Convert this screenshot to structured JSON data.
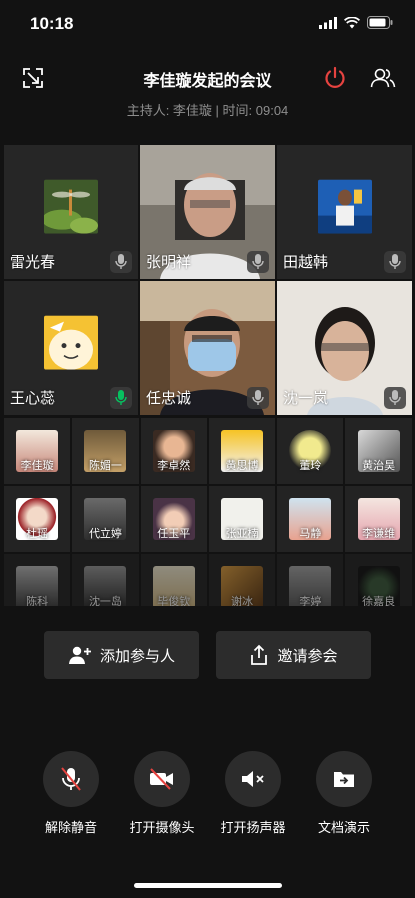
{
  "status_bar": {
    "time": "10:18"
  },
  "meeting": {
    "title": "李佳璇发起的会议",
    "info": "主持人: 李佳璇 | 时间: 09:04"
  },
  "icons": {
    "minimize": "minimize-window-icon",
    "end": "power-icon",
    "participants": "participants-icon"
  },
  "colors": {
    "end_button": "#e64340",
    "mic_active": "#07c160",
    "background": "#121212"
  },
  "big_participants": [
    {
      "name": "雷光春",
      "mic": "muted"
    },
    {
      "name": "张明祥",
      "mic": "muted"
    },
    {
      "name": "田越韩",
      "mic": "muted"
    },
    {
      "name": "王心蕊",
      "mic": "active"
    },
    {
      "name": "任忠诚",
      "mic": "muted"
    },
    {
      "name": "沈一岚",
      "mic": "muted"
    }
  ],
  "small_participants": [
    {
      "name": "李佳璇"
    },
    {
      "name": "陈媚一"
    },
    {
      "name": "李卓然"
    },
    {
      "name": "黄思博"
    },
    {
      "name": "董玲"
    },
    {
      "name": "黄治昊"
    },
    {
      "name": "杜瑶"
    },
    {
      "name": "代立婷"
    },
    {
      "name": "任玉平"
    },
    {
      "name": "张亚楠"
    },
    {
      "name": "马静"
    },
    {
      "name": "李谦维"
    },
    {
      "name": "陈科"
    },
    {
      "name": "沈一岛"
    },
    {
      "name": "毕俊钦"
    },
    {
      "name": "谢冰"
    },
    {
      "name": "李婷"
    },
    {
      "name": "徐嘉良"
    }
  ],
  "actions": {
    "add_participant": "添加参与人",
    "invite": "邀请参会"
  },
  "controls": [
    {
      "label": "解除静音",
      "icon": "mic-off-icon"
    },
    {
      "label": "打开摄像头",
      "icon": "camera-off-icon"
    },
    {
      "label": "打开扬声器",
      "icon": "speaker-off-icon"
    },
    {
      "label": "文档演示",
      "icon": "document-share-icon"
    }
  ]
}
